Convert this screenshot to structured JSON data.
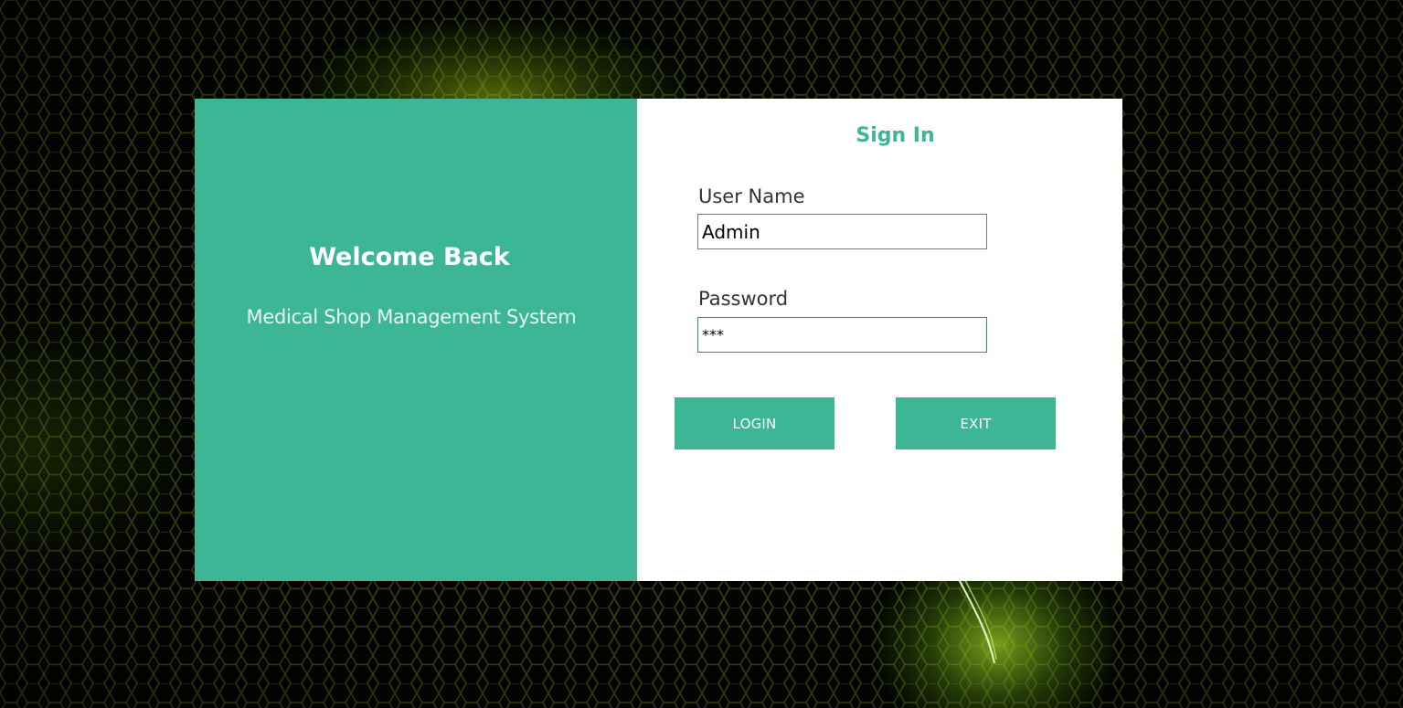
{
  "app": {
    "welcome_title": "Welcome Back",
    "welcome_subtitle": "Medical Shop Management System"
  },
  "signin": {
    "title": "Sign In",
    "username_label": "User Name",
    "username_value": "Admin",
    "password_label": "Password",
    "password_value": "***",
    "login_label": "LOGIN",
    "exit_label": "EXIT"
  },
  "theme": {
    "accent": "#3db695",
    "panel_bg": "#ffffff",
    "background": "#030401",
    "hex_line": "#5d7a12",
    "focus_border": "#2e7bcf"
  }
}
